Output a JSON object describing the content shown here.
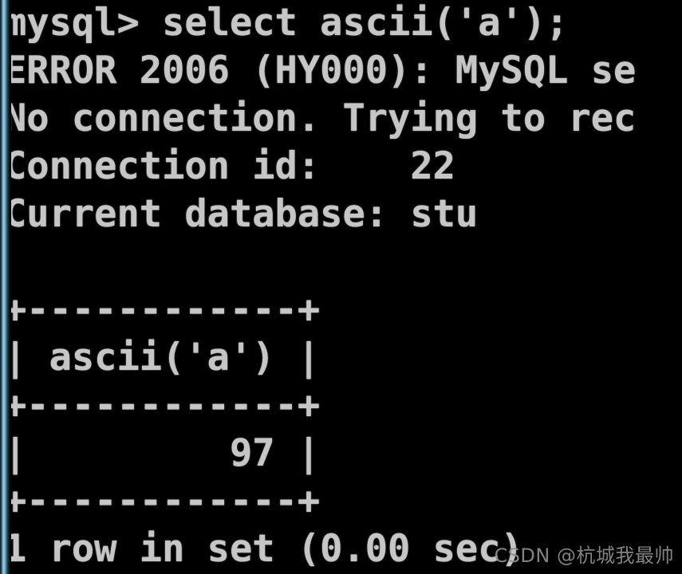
{
  "terminal": {
    "background_color": "#000000",
    "text_color": "#c6c6c6",
    "edge_accent_color": "#9fcde6",
    "prompt": "mysql>",
    "lines": [
      "mysql> select ascii('a');",
      "ERROR 2006 (HY000): MySQL se",
      "No connection. Trying to rec",
      "Connection id:    22",
      "Current database: stu",
      "",
      "+------------+",
      "| ascii('a') |",
      "+------------+",
      "|         97 |",
      "+------------+",
      "1 row in set (0.00 sec)"
    ],
    "command": "select ascii('a');",
    "error": {
      "code": "2006",
      "sqlstate": "HY000",
      "message": "MySQL se"
    },
    "reconnect_notice": "No connection. Trying to rec",
    "connection_id_label": "Connection id:",
    "connection_id_value": "22",
    "current_database_label": "Current database:",
    "current_database_value": "stu",
    "result_table": {
      "separator": "+------------+",
      "header_row": "| ascii('a') |",
      "header": "ascii('a')",
      "value_row": "|         97 |",
      "value": "97"
    },
    "status": "1 row in set (0.00 sec)",
    "row_count": "1",
    "elapsed": "0.00 sec"
  },
  "watermark": {
    "text": "CSDN @杭城我最帅",
    "color": "#8d8d8d"
  }
}
